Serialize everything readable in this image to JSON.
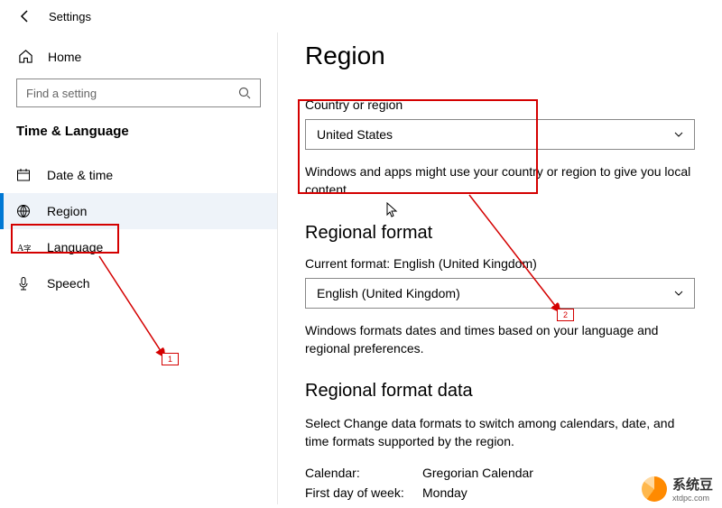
{
  "topbar": {
    "title": "Settings"
  },
  "sidebar": {
    "home": "Home",
    "search_placeholder": "Find a setting",
    "section": "Time & Language",
    "items": [
      {
        "label": "Date & time"
      },
      {
        "label": "Region"
      },
      {
        "label": "Language"
      },
      {
        "label": "Speech"
      }
    ]
  },
  "page": {
    "heading": "Region",
    "country": {
      "label": "Country or region",
      "value": "United States",
      "hint": "Windows and apps might use your country or region to give you local content."
    },
    "regional_format": {
      "heading": "Regional format",
      "current_label": "Current format: English (United Kingdom)",
      "value": "English (United Kingdom)",
      "hint": "Windows formats dates and times based on your language and regional preferences."
    },
    "format_data": {
      "heading": "Regional format data",
      "hint": "Select Change data formats to switch among calendars, date, and time formats supported by the region.",
      "rows": [
        {
          "k": "Calendar:",
          "v": "Gregorian Calendar"
        },
        {
          "k": "First day of week:",
          "v": "Monday"
        }
      ]
    }
  },
  "annotations": {
    "callout1": "1",
    "callout2": "2"
  },
  "watermark": {
    "name": "系统豆",
    "url": "xtdpc.com"
  }
}
